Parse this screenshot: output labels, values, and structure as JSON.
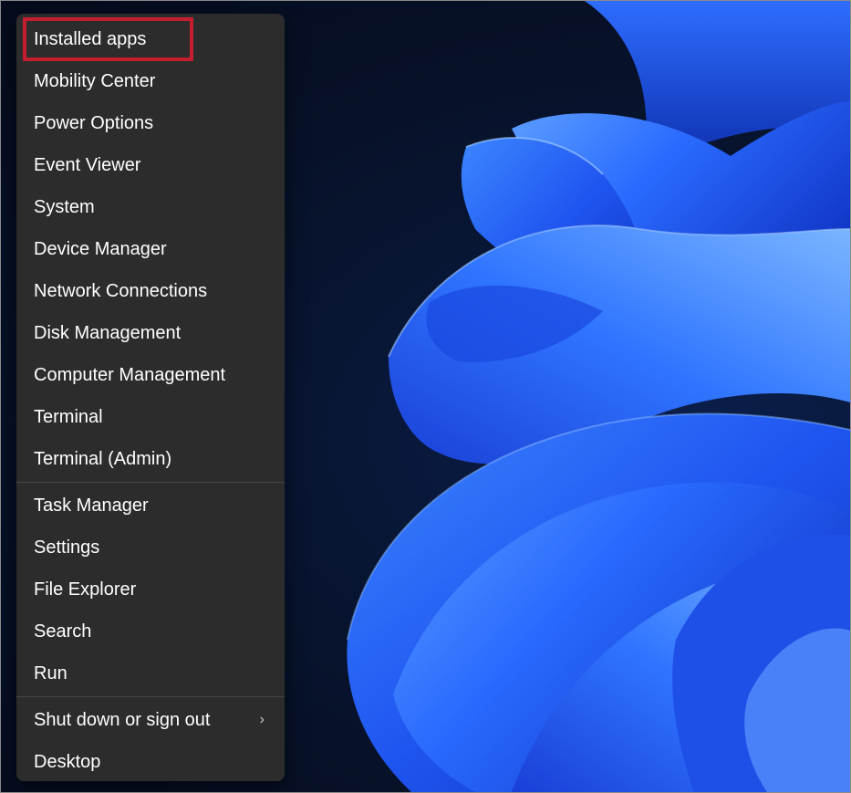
{
  "menu": {
    "groups": [
      {
        "items": [
          {
            "label": "Installed apps",
            "name": "menu-item-installed-apps"
          },
          {
            "label": "Mobility Center",
            "name": "menu-item-mobility-center"
          },
          {
            "label": "Power Options",
            "name": "menu-item-power-options"
          },
          {
            "label": "Event Viewer",
            "name": "menu-item-event-viewer"
          },
          {
            "label": "System",
            "name": "menu-item-system"
          },
          {
            "label": "Device Manager",
            "name": "menu-item-device-manager"
          },
          {
            "label": "Network Connections",
            "name": "menu-item-network-connections"
          },
          {
            "label": "Disk Management",
            "name": "menu-item-disk-management"
          },
          {
            "label": "Computer Management",
            "name": "menu-item-computer-management"
          },
          {
            "label": "Terminal",
            "name": "menu-item-terminal"
          },
          {
            "label": "Terminal (Admin)",
            "name": "menu-item-terminal-admin"
          }
        ]
      },
      {
        "items": [
          {
            "label": "Task Manager",
            "name": "menu-item-task-manager"
          },
          {
            "label": "Settings",
            "name": "menu-item-settings"
          },
          {
            "label": "File Explorer",
            "name": "menu-item-file-explorer"
          },
          {
            "label": "Search",
            "name": "menu-item-search"
          },
          {
            "label": "Run",
            "name": "menu-item-run"
          }
        ]
      },
      {
        "items": [
          {
            "label": "Shut down or sign out",
            "name": "menu-item-shut-down-or-sign-out",
            "submenu_icon": "chevron-right-icon"
          },
          {
            "label": "Desktop",
            "name": "menu-item-desktop"
          }
        ]
      }
    ],
    "chevron_glyph": "›",
    "highlighted_item": "Installed apps"
  },
  "colors": {
    "menu_background": "#2c2c2c",
    "highlight_border": "#c41e2e",
    "wallpaper_blue": "#1e5cff"
  }
}
